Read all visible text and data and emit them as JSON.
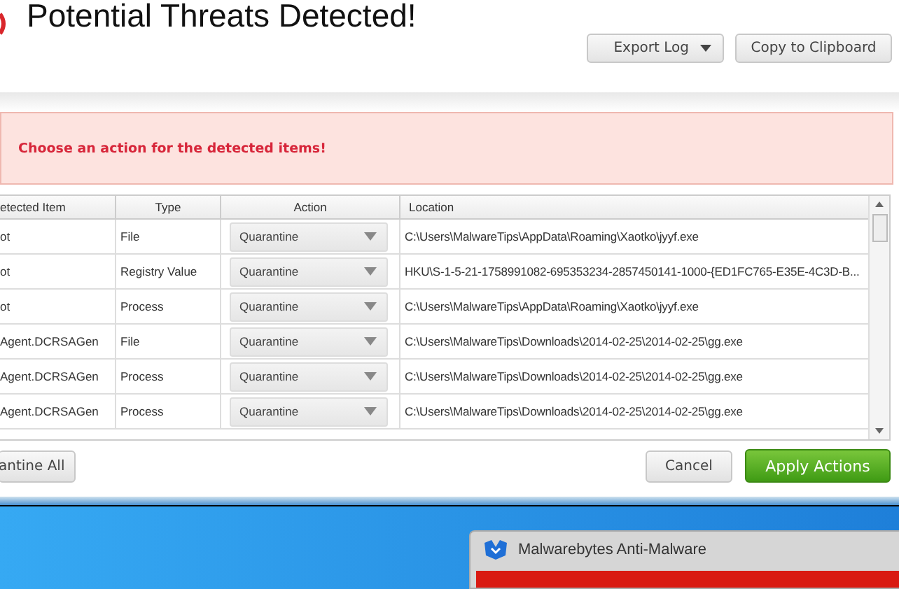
{
  "window": {
    "title": "Potential Threats Detected!"
  },
  "toolbar": {
    "buttons": [
      {
        "label": "Export Log",
        "kind": "dropdown"
      },
      {
        "label": "Copy to Clipboard",
        "kind": "plain"
      }
    ]
  },
  "alert": {
    "message": "Choose an action for the detected items!"
  },
  "table": {
    "columns": [
      "etected Item",
      "Type",
      "Action",
      "Location"
    ],
    "rows": [
      {
        "item": "ot",
        "type": "File",
        "action": "Quarantine",
        "location": "C:\\Users\\MalwareTips\\AppData\\Roaming\\Xaotko\\jyyf.exe"
      },
      {
        "item": "ot",
        "type": "Registry Value",
        "action": "Quarantine",
        "location": "HKU\\S-1-5-21-1758991082-695353234-2857450141-1000-{ED1FC765-E35E-4C3D-B..."
      },
      {
        "item": "ot",
        "type": "Process",
        "action": "Quarantine",
        "location": "C:\\Users\\MalwareTips\\AppData\\Roaming\\Xaotko\\jyyf.exe"
      },
      {
        "item": "Agent.DCRSAGen",
        "type": "File",
        "action": "Quarantine",
        "location": "C:\\Users\\MalwareTips\\Downloads\\2014-02-25\\2014-02-25\\gg.exe"
      },
      {
        "item": "Agent.DCRSAGen",
        "type": "Process",
        "action": "Quarantine",
        "location": "C:\\Users\\MalwareTips\\Downloads\\2014-02-25\\2014-02-25\\gg.exe"
      },
      {
        "item": "Agent.DCRSAGen",
        "type": "Process",
        "action": "Quarantine",
        "location": "C:\\Users\\MalwareTips\\Downloads\\2014-02-25\\2014-02-25\\gg.exe"
      }
    ]
  },
  "footer": {
    "quarantine_all": "antine All",
    "cancel": "Cancel",
    "apply": "Apply Actions"
  },
  "background_window": {
    "title": "Malwarebytes Anti-Malware"
  }
}
